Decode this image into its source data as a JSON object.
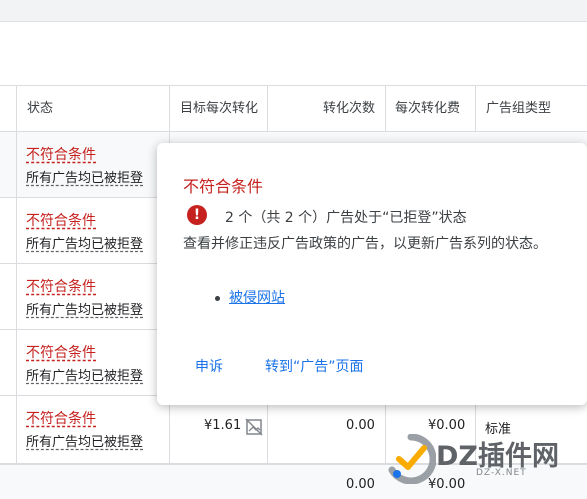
{
  "columns": [
    "状态",
    "目标每次转化",
    "转化次数",
    "每次转化费",
    "广告组类型"
  ],
  "rows": [
    {
      "status": "不符合条件",
      "detail": "所有广告均已被拒登"
    },
    {
      "status": "不符合条件",
      "detail": "所有广告均已被拒登"
    },
    {
      "status": "不符合条件",
      "detail": "所有广告均已被拒登"
    },
    {
      "status": "不符合条件",
      "detail": "所有广告均已被拒登"
    },
    {
      "status": "不符合条件",
      "detail": "所有广告均已被拒登",
      "target": "¥1.61",
      "conversions": "0.00",
      "cost": "¥0.00",
      "type": "标准"
    }
  ],
  "totals": {
    "conversions": "0.00",
    "cost": "¥0.00"
  },
  "popup": {
    "title": "不符合条件",
    "count_text": "2 个（共 2 个）广告处于“已拒登”状态",
    "description": "查看并修正违反广告政策的广告，以更新广告系列的状态。",
    "link": "被侵网站",
    "appeal_label": "申诉",
    "goto_label": "转到“广告”页面"
  },
  "watermark": {
    "logo": "DZ插件网",
    "url": "DZ-X.NET"
  },
  "colors": {
    "error": "#c5221f",
    "link": "#1a73e8"
  }
}
